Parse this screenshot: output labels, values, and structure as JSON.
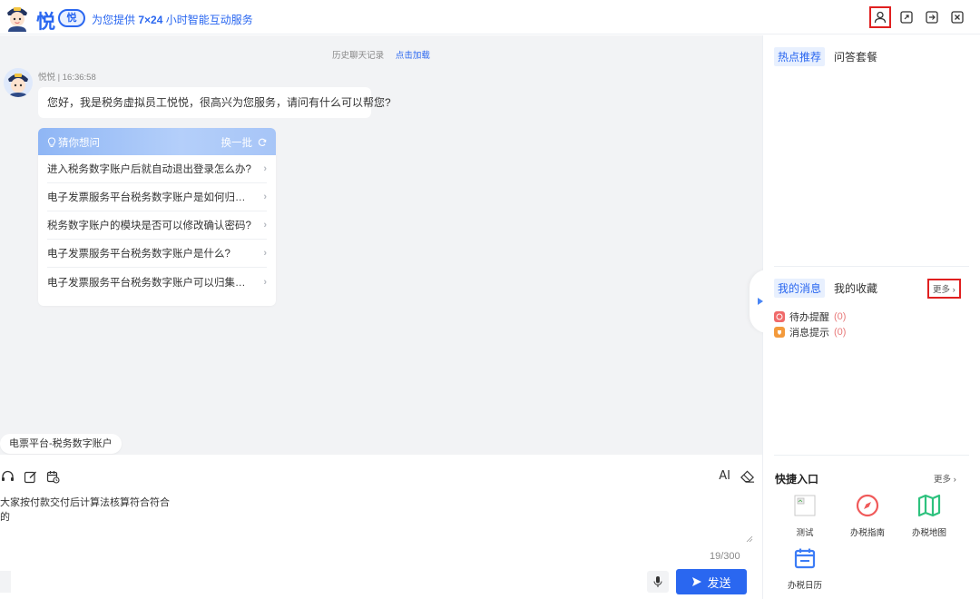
{
  "header": {
    "brand": "悦",
    "badge": "悦",
    "slogan_prefix": "为您提供",
    "slogan_bold": "7×24",
    "slogan_suffix": "小时智能互动服务"
  },
  "chat": {
    "history_label": "历史聊天记录",
    "history_link": "点击加载",
    "bot_meta": "悦悦 | 16:36:58",
    "greeting": "您好，我是税务虚拟员工悦悦，很高兴为您服务，请问有什么可以帮您?",
    "guess": {
      "title": "猜你想问",
      "swap": "换一批",
      "items": [
        "进入税务数字账户后就自动退出登录怎么办?",
        "电子发票服务平台税务数字账户是如何归集发票的?",
        "税务数字账户的模块是否可以修改确认密码?",
        "电子发票服务平台税务数字账户是什么?",
        "电子发票服务平台税务数字账户可以归集哪些发票?"
      ]
    },
    "tag": "电票平台-税务数字账户"
  },
  "input": {
    "ai_label": "AI",
    "text_line1": "大家按付款交付后计算法核算符合符合",
    "text_line2": "的",
    "counter": "19/300",
    "send_label": "发送"
  },
  "right": {
    "hot_tab": "热点推荐",
    "qa_tab": "问答套餐",
    "msg_tab": "我的消息",
    "fav_tab": "我的收藏",
    "more_msg": "更多 ›",
    "todo_label": "待办提醒",
    "todo_count": "(0)",
    "notice_label": "消息提示",
    "notice_count": "(0)",
    "quick_title": "快捷入口",
    "quick_more": "更多 ›",
    "quick": [
      {
        "label": "测试",
        "icon": "broken-image-icon"
      },
      {
        "label": "办税指南",
        "icon": "compass-icon"
      },
      {
        "label": "办税地图",
        "icon": "map-icon"
      },
      {
        "label": "办税日历",
        "icon": "calendar-icon"
      }
    ]
  },
  "colors": {
    "accent": "#2a67f0",
    "highlight_box": "#e02020",
    "compass": "#f05a5a",
    "map": "#2ec27e"
  }
}
